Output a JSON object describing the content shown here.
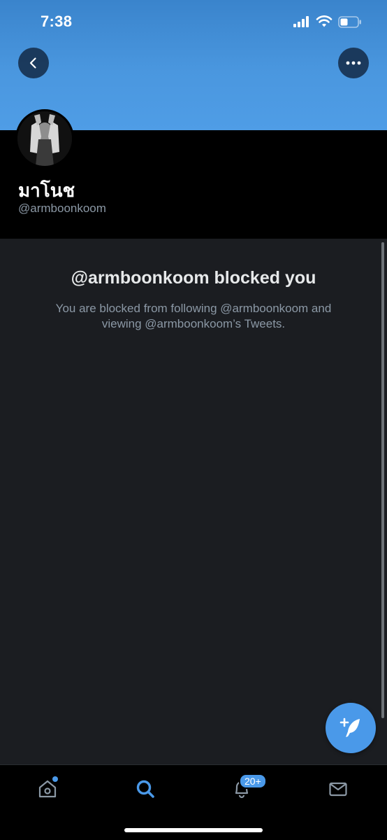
{
  "status_bar": {
    "time": "7:38",
    "icons": [
      "signal-icon",
      "wifi-icon",
      "battery-icon"
    ]
  },
  "header": {
    "back_icon": "chevron-left-icon",
    "more_icon": "more-horizontal-icon"
  },
  "profile": {
    "display_name": "มาโนช",
    "handle": "@armboonkoom"
  },
  "blocked": {
    "title": "@armboonkoom blocked you",
    "message": "You are blocked from following @armboonkoom and viewing @armboonkoom’s Tweets."
  },
  "compose": {
    "icon": "compose-tweet-icon"
  },
  "tab_bar": {
    "tabs": [
      {
        "name": "home",
        "icon": "home-icon",
        "has_dot": true
      },
      {
        "name": "search",
        "icon": "search-icon",
        "active": true
      },
      {
        "name": "notifications",
        "icon": "bell-icon",
        "badge": "20+"
      },
      {
        "name": "messages",
        "icon": "mail-icon"
      }
    ]
  },
  "colors": {
    "accent": "#4a99e9",
    "banner": "#4a97df",
    "background": "#1b1d21",
    "muted_text": "#8b98a5"
  }
}
